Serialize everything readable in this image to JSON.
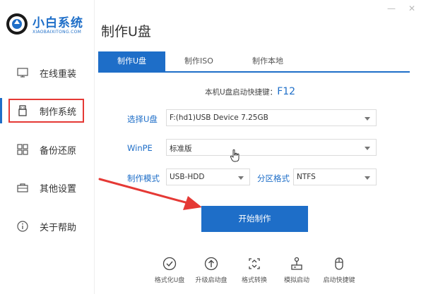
{
  "window": {
    "minimize_glyph": "—",
    "close_glyph": "✕"
  },
  "logo": {
    "title": "小白系统",
    "subtitle": "XIAOBAIXITONG.COM",
    "icon": "xiaobai-logo-icon"
  },
  "sidebar": {
    "items": [
      {
        "label": "在线重装",
        "icon": "monitor-icon",
        "active": false
      },
      {
        "label": "制作系统",
        "icon": "usb-drive-icon",
        "active": true
      },
      {
        "label": "备份还原",
        "icon": "grid-icon",
        "active": false
      },
      {
        "label": "其他设置",
        "icon": "briefcase-icon",
        "active": false
      },
      {
        "label": "关于帮助",
        "icon": "info-icon",
        "active": false
      }
    ]
  },
  "page": {
    "title": "制作U盘"
  },
  "tabs": [
    {
      "label": "制作U盘",
      "active": true
    },
    {
      "label": "制作ISO",
      "active": false
    },
    {
      "label": "制作本地",
      "active": false
    }
  ],
  "hotkey": {
    "text": "本机U盘启动快捷键：",
    "key": "F12"
  },
  "form": {
    "usb_label": "选择U盘",
    "usb_value": "F:(hd1)USB Device 7.25GB",
    "winpe_label": "WinPE",
    "winpe_value": "标准版",
    "mode_label": "制作模式",
    "mode_value": "USB-HDD",
    "partition_label": "分区格式",
    "partition_value": "NTFS"
  },
  "start_button": "开始制作",
  "tools": [
    {
      "label": "格式化U盘",
      "icon": "check-circle-icon"
    },
    {
      "label": "升级启动盘",
      "icon": "upload-circle-icon"
    },
    {
      "label": "格式转换",
      "icon": "convert-icon"
    },
    {
      "label": "模拟启动",
      "icon": "simulate-icon"
    },
    {
      "label": "启动快捷键",
      "icon": "mouse-icon"
    }
  ],
  "colors": {
    "accent": "#1e6ec8",
    "highlight": "#e53935"
  }
}
